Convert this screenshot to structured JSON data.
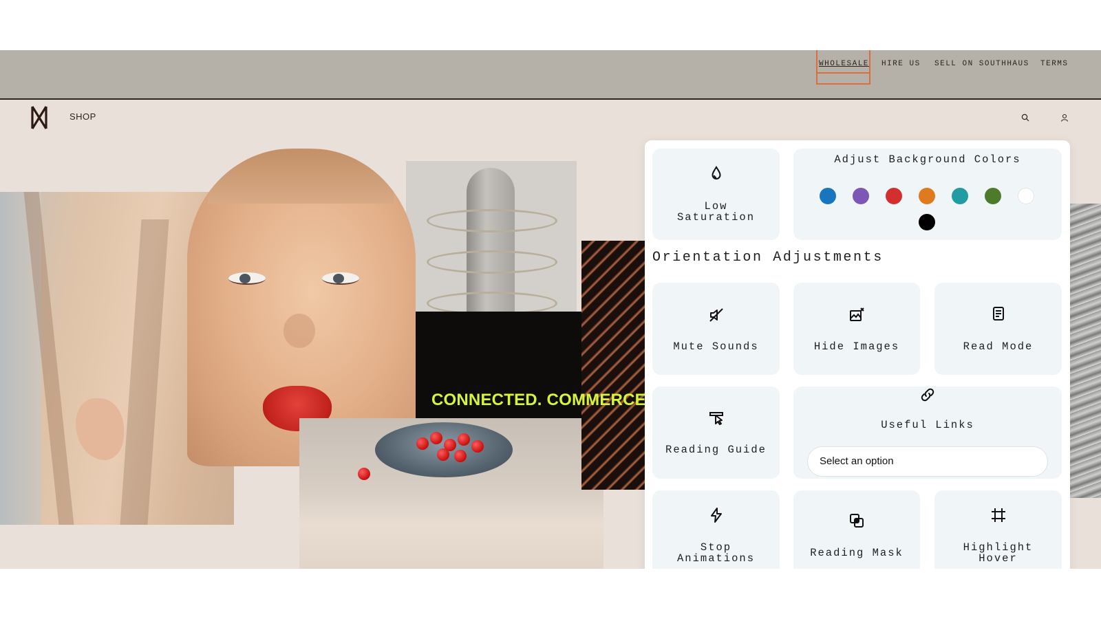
{
  "top_links": {
    "wholesale": "WHOLESALE",
    "hire_us": "HIRE US",
    "sell": "SELL ON SOUTHHAUS",
    "terms": "TERMS"
  },
  "nav": {
    "logo_icon": "brand-monogram-icon",
    "shop": "SHOP",
    "search_icon": "search-icon",
    "account_icon": "user-icon"
  },
  "hero": {
    "tagline": "CONNECTED. COMMERCE"
  },
  "panel": {
    "low_saturation": "Low\nSaturation",
    "bg_colors_title": "Adjust Background Colors",
    "swatches": [
      "#1976bd",
      "#7e57b6",
      "#d32f2f",
      "#e07a1f",
      "#209ca2",
      "#4e7a2c",
      "#ffffff",
      "#000000"
    ],
    "section_title": "Orientation Adjustments",
    "mute_sounds": "Mute Sounds",
    "hide_images": "Hide Images",
    "read_mode": "Read Mode",
    "reading_guide": "Reading Guide",
    "useful_links": "Useful Links",
    "useful_links_select": "Select an option",
    "stop_animations": "Stop\nAnimations",
    "reading_mask": "Reading Mask",
    "highlight_hover": "Highlight\nHover"
  },
  "colors": {
    "topbar": "#b5b0a8",
    "page_bg": "#e9e1d9",
    "highlight_box": "#d9703a",
    "tagline": "#d4f53c",
    "card_bg": "#f0f5f8"
  }
}
